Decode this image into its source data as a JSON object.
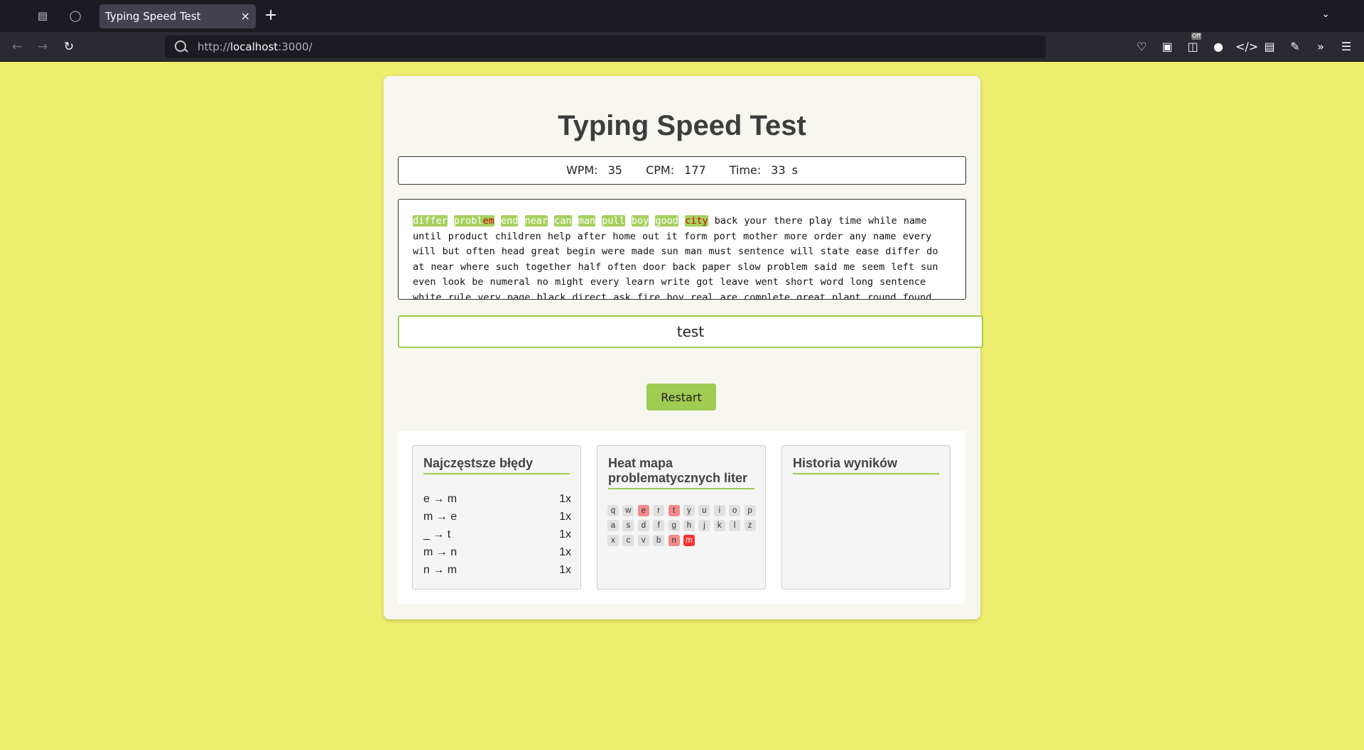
{
  "browser": {
    "tab_title": "Typing Speed Test",
    "url_prefix": "http://",
    "url_host": "localhost",
    "url_rest": ":3000/",
    "new_tab_symbol": "+",
    "close_symbol": "×",
    "ext_badge": "Off"
  },
  "app": {
    "title": "Typing Speed Test",
    "stats": {
      "wpm_label": "WPM:",
      "wpm": "35",
      "cpm_label": "CPM:",
      "cpm": "177",
      "time_label": "Time:",
      "time": "33",
      "time_unit": "s"
    },
    "typed_words": [
      {
        "text": "differ",
        "status": "ok"
      },
      {
        "text": "probl",
        "error_suffix": "em",
        "status": "err"
      },
      {
        "text": "end",
        "status": "ok"
      },
      {
        "text": "near",
        "status": "ok"
      },
      {
        "text": "can",
        "status": "ok"
      },
      {
        "text": "man",
        "status": "ok"
      },
      {
        "text": "pull",
        "status": "ok"
      },
      {
        "text": "boy",
        "status": "ok"
      },
      {
        "text": "good",
        "status": "ok"
      },
      {
        "text": "city",
        "status": "err_full"
      }
    ],
    "remaining_text": "back your there play time while name until product children help after home out it form port mother more order any name every will but often head great begin were made sun man must sentence will state ease differ do at near where such together half often door back paper slow problem said me seem left sun even look be numeral no might every learn write got leave went short word long sentence white rule very page black direct ask fire boy real are complete great plant round found",
    "input_value": "test",
    "restart_label": "Restart"
  },
  "errors_panel": {
    "title": "Najczęstsze błędy",
    "rows": [
      {
        "pair": "e → m",
        "count": "1x"
      },
      {
        "pair": "m → e",
        "count": "1x"
      },
      {
        "pair": "_ → t",
        "count": "1x"
      },
      {
        "pair": "m → n",
        "count": "1x"
      },
      {
        "pair": "n → m",
        "count": "1x"
      }
    ]
  },
  "heatmap_panel": {
    "title": "Heat mapa problematycznych liter",
    "rows": [
      [
        {
          "k": "q",
          "lvl": 0
        },
        {
          "k": "w",
          "lvl": 0
        },
        {
          "k": "e",
          "lvl": 1
        },
        {
          "k": "r",
          "lvl": 0
        },
        {
          "k": "t",
          "lvl": 1
        },
        {
          "k": "y",
          "lvl": 0
        },
        {
          "k": "u",
          "lvl": 0
        },
        {
          "k": "i",
          "lvl": 0
        },
        {
          "k": "o",
          "lvl": 0
        },
        {
          "k": "p",
          "lvl": 0
        }
      ],
      [
        {
          "k": "a",
          "lvl": 0
        },
        {
          "k": "s",
          "lvl": 0
        },
        {
          "k": "d",
          "lvl": 0
        },
        {
          "k": "f",
          "lvl": 0
        },
        {
          "k": "g",
          "lvl": 0
        },
        {
          "k": "h",
          "lvl": 0
        },
        {
          "k": "j",
          "lvl": 0
        },
        {
          "k": "k",
          "lvl": 0
        },
        {
          "k": "l",
          "lvl": 0
        },
        {
          "k": "z",
          "lvl": 0
        }
      ],
      [
        {
          "k": "x",
          "lvl": 0
        },
        {
          "k": "c",
          "lvl": 0
        },
        {
          "k": "v",
          "lvl": 0
        },
        {
          "k": "b",
          "lvl": 0
        },
        {
          "k": "n",
          "lvl": 1
        },
        {
          "k": "m",
          "lvl": 2
        }
      ]
    ]
  },
  "history_panel": {
    "title": "Historia wyników"
  },
  "colors": {
    "page_bg": "#eeee6e",
    "accent": "#9fcc52",
    "error": "#cc0000"
  }
}
